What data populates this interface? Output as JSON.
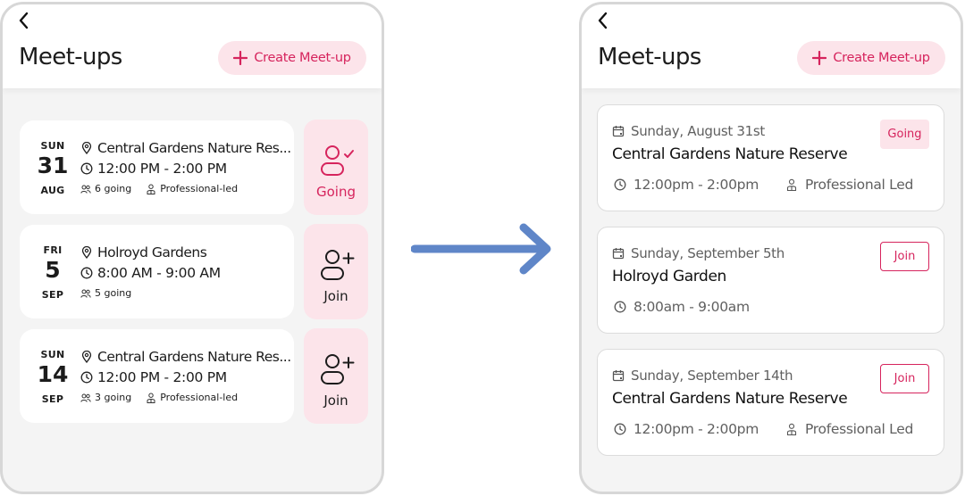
{
  "colors": {
    "accent": "#d6245d",
    "accent_bg": "#fce4ea",
    "arrow": "#5f86c8"
  },
  "before": {
    "title": "Meet-ups",
    "create_label": "Create Meet-up",
    "cards": [
      {
        "dow": "SUN",
        "day": "31",
        "month": "AUG",
        "location": "Central Gardens Nature Res...",
        "time": "12:00 PM - 2:00 PM",
        "attendees": "6 going",
        "tag": "Professional-led",
        "action": "Going"
      },
      {
        "dow": "FRI",
        "day": "5",
        "month": "SEP",
        "location": "Holroyd Gardens",
        "time": "8:00 AM - 9:00 AM",
        "attendees": "5 going",
        "tag": "",
        "action": "Join"
      },
      {
        "dow": "SUN",
        "day": "14",
        "month": "SEP",
        "location": "Central Gardens Nature Res...",
        "time": "12:00 PM - 2:00 PM",
        "attendees": "3 going",
        "tag": "Professional-led",
        "action": "Join"
      }
    ]
  },
  "after": {
    "title": "Meet-ups",
    "create_label": "Create Meet-up",
    "cards": [
      {
        "date": "Sunday, August 31st",
        "location": "Central Gardens Nature Reserve",
        "time": "12:00pm - 2:00pm",
        "tag": "Professional Led",
        "action": "Going"
      },
      {
        "date": "Sunday, September 5th",
        "location": "Holroyd Garden",
        "time": "8:00am - 9:00am",
        "tag": "",
        "action": "Join"
      },
      {
        "date": "Sunday, September 14th",
        "location": "Central Gardens Nature Reserve",
        "time": "12:00pm - 2:00pm",
        "tag": "Professional Led",
        "action": "Join"
      }
    ]
  }
}
